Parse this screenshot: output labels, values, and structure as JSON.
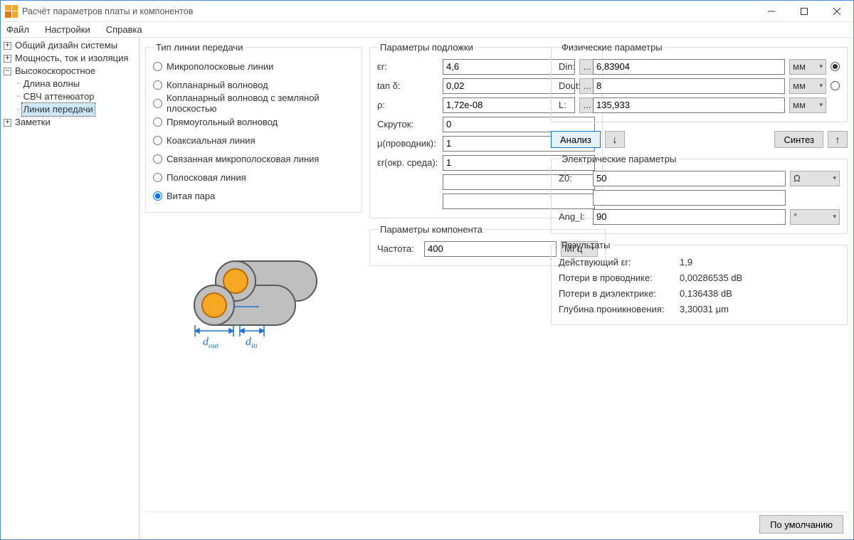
{
  "titlebar": {
    "title": "Расчёт параметров платы и компонентов"
  },
  "menu": {
    "file": "Файл",
    "settings": "Настройки",
    "help": "Справка"
  },
  "tree": {
    "top": "Общий дизайн системы",
    "power": "Мощность, ток и изоляция",
    "highspeed": "Высокоскоростное",
    "wavelength": "Длина волны",
    "attenuator": "СВЧ аттенюатор",
    "lines": "Линии передачи",
    "notes": "Заметки"
  },
  "linetype": {
    "legend": "Тип линии передачи",
    "items": [
      "Микрополосковые линии",
      "Копланарный волновод",
      "Копланарный волновод с земляной плоскостью",
      "Прямоугольный волновод",
      "Коаксиальная линия",
      "Связанная микрополосковая линия",
      "Полосковая линия",
      "Витая пара"
    ],
    "selected_index": 7
  },
  "diagram": {
    "d_out": "d",
    "d_out_sub": "out",
    "d_in": "d",
    "d_in_sub": "in"
  },
  "substrate": {
    "legend": "Параметры подложки",
    "rows": {
      "er": {
        "label": "εr:",
        "value": "4,6"
      },
      "tand": {
        "label": "tan δ:",
        "value": "0,02"
      },
      "rho": {
        "label": "ρ:",
        "value": "1,72e-08"
      },
      "twist": {
        "label": "Скруток:",
        "value": "0"
      },
      "murc": {
        "label": "μ(проводник):",
        "value": "1"
      },
      "ersurr": {
        "label": "εr(окр. среда):",
        "value": "1"
      }
    },
    "more": "..."
  },
  "component": {
    "legend": "Параметры компонента",
    "freq_label": "Частота:",
    "freq_value": "400",
    "freq_unit": "МГц"
  },
  "physical": {
    "legend": "Физические параметры",
    "din": {
      "label": "Din:",
      "value": "6,83904",
      "unit": "мм"
    },
    "dout": {
      "label": "Dout:",
      "value": "8",
      "unit": "мм"
    },
    "l": {
      "label": "L:",
      "value": "135,933",
      "unit": "мм"
    }
  },
  "actions": {
    "analyze": "Анализ",
    "down": "↓",
    "synth": "Синтез",
    "up": "↑"
  },
  "electrical": {
    "legend": "Электрические параметры",
    "z0": {
      "label": "Z0:",
      "value": "50",
      "unit": "Ω"
    },
    "angl": {
      "label": "Ang_l:",
      "value": "90",
      "unit": "°"
    }
  },
  "results": {
    "legend": "Результаты",
    "rows": [
      {
        "label": "Действующий εr:",
        "value": "1,9"
      },
      {
        "label": "Потери в проводнике:",
        "value": "0,00286535 dB"
      },
      {
        "label": "Потери в диэлектрике:",
        "value": "0,136438 dB"
      },
      {
        "label": "Глубина проникновения:",
        "value": "3,30031 μm"
      }
    ]
  },
  "bottom": {
    "defaults": "По умолчанию"
  }
}
